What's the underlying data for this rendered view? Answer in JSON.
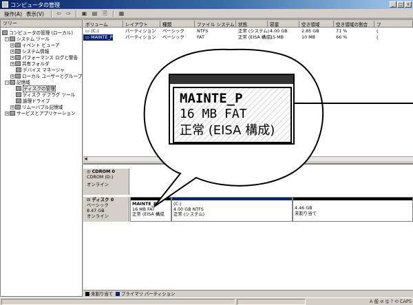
{
  "window": {
    "title": "コンピュータの管理"
  },
  "menubar": {
    "action": "操作(A)",
    "view": "表示(V)",
    "back_icon": "left-arrow",
    "forward_icon": "right-arrow"
  },
  "tree": {
    "header": "ツリー",
    "items": [
      {
        "label": "コンピュータの管理 (ローカル)"
      },
      {
        "label": "システム ツール"
      },
      {
        "label": "イベント ビューア"
      },
      {
        "label": "システム情報"
      },
      {
        "label": "パフォーマンス ログと警告"
      },
      {
        "label": "共有フォルダ"
      },
      {
        "label": "デバイス マネージャ"
      },
      {
        "label": "ローカル ユーザーとグループ"
      },
      {
        "label": "記憶域"
      },
      {
        "label": "ディスクの管理"
      },
      {
        "label": "ディスク デフラグ ツール"
      },
      {
        "label": "論理ドライブ"
      },
      {
        "label": "リムーバブル記憶域"
      },
      {
        "label": "サービスとアプリケーション"
      }
    ]
  },
  "volume_list": {
    "columns": [
      "ボリューム",
      "レイアウト",
      "種類",
      "ファイル システム",
      "状態",
      "容量",
      "空き領域",
      "空き領域の割合",
      "フ"
    ],
    "rows": [
      {
        "volume": "(C:)",
        "layout": "パーティション",
        "type": "ベーシック",
        "fs": "NTFS",
        "status": "正常 (システム)",
        "capacity": "4.00 GB",
        "free": "2.85 GB",
        "pct": "71 %",
        "extra": "("
      },
      {
        "volume": "MAINTE_P",
        "layout": "パーティション",
        "type": "ベーシック",
        "fs": "FAT",
        "status": "正常 (EISA 構成)",
        "capacity": "15 MB",
        "free": "10 MB",
        "pct": "66 %",
        "extra": "("
      }
    ]
  },
  "disks": [
    {
      "name": "CDROM 0",
      "sub": "CDROM (D:)",
      "state": "オンライン"
    },
    {
      "name": "ディスク 0",
      "type": "ベーシック",
      "size": "8.47 GB",
      "state": "オンライン"
    }
  ],
  "partitions": [
    {
      "name": "MAINTE_P",
      "size": "16 MB FAT",
      "status": "正常 (EISA 構成",
      "color": "#000000"
    },
    {
      "name": "(C:)",
      "size": "4.00 GB NTFS",
      "status": "正常 (システム)",
      "color": "#0a246a"
    },
    {
      "name": "",
      "size": "4.46 GB",
      "status": "未割り当て",
      "color": "#000000"
    }
  ],
  "legend": {
    "unallocated": "未割り当て",
    "primary": "プライマリ パーティション"
  },
  "callout": {
    "line1": "MAINTE_P",
    "line2": "16 MB FAT",
    "line3": "正常 (EISA 構成)"
  },
  "tray": {
    "text": "A 般 ⊘ 🖫 ? ⟲ CAPS"
  },
  "icons": {
    "app": "computer-management-icon",
    "disk": "disk-icon",
    "cdrom": "cdrom-icon",
    "folder": "folder-icon"
  }
}
